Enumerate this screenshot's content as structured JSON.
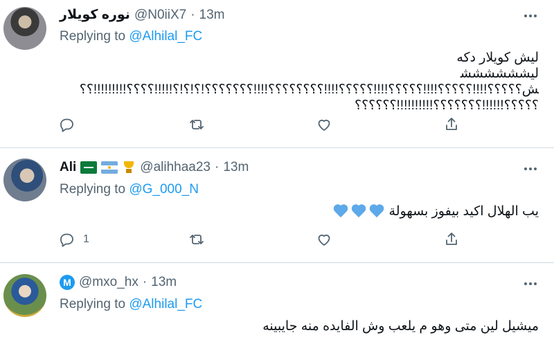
{
  "tweets": [
    {
      "name": "نوره كويلار",
      "handle": "@N0iiX7",
      "dot": "·",
      "time": "13m",
      "reply_prefix": "Replying to ",
      "reply_to": "@Alhilal_FC",
      "text_lines": [
        "ليش كويلار دكه",
        "ليششششششش؟؟؟؟؟!!!!؟؟؟؟؟!!!!؟؟؟؟؟!!!!؟؟؟؟؟!!!!؟؟؟؟؟؟؟؟!!!!؟؟؟؟؟؟؟!؟!؟!؟!!!!!؟؟؟؟!!!!!!!!!؟؟",
        "؟؟؟؟؟!!!!!!؟؟؟؟؟؟؟!!!!!!!!!!؟؟؟؟؟؟"
      ],
      "actions": {
        "reply_count": "",
        "retweet_count": "",
        "like_count": ""
      }
    },
    {
      "name": "Ali",
      "handle": "@alihhaa23",
      "dot": "·",
      "time": "13m",
      "reply_prefix": "Replying to ",
      "reply_to": "@G_000_N",
      "text": "يب الهلال اكيد بيفوز بسهولة",
      "emoji_hearts": "💙💙💙",
      "actions": {
        "reply_count": "1",
        "retweet_count": "",
        "like_count": ""
      }
    },
    {
      "name": "",
      "badge_letter": "M",
      "handle": "@mxo_hx",
      "dot": "·",
      "time": "13m",
      "reply_prefix": "Replying to ",
      "reply_to": "@Alhilal_FC",
      "text": "ميشيل لين متى وهو م يلعب وش الفايده منه جايبينه"
    }
  ],
  "colors": {
    "accent": "#1d9bf0",
    "muted": "#536471",
    "divider": "#cfd9de",
    "heart_emoji": "#5da9e9"
  },
  "icons": [
    "more-icon",
    "reply-icon",
    "retweet-icon",
    "like-icon",
    "share-icon"
  ]
}
